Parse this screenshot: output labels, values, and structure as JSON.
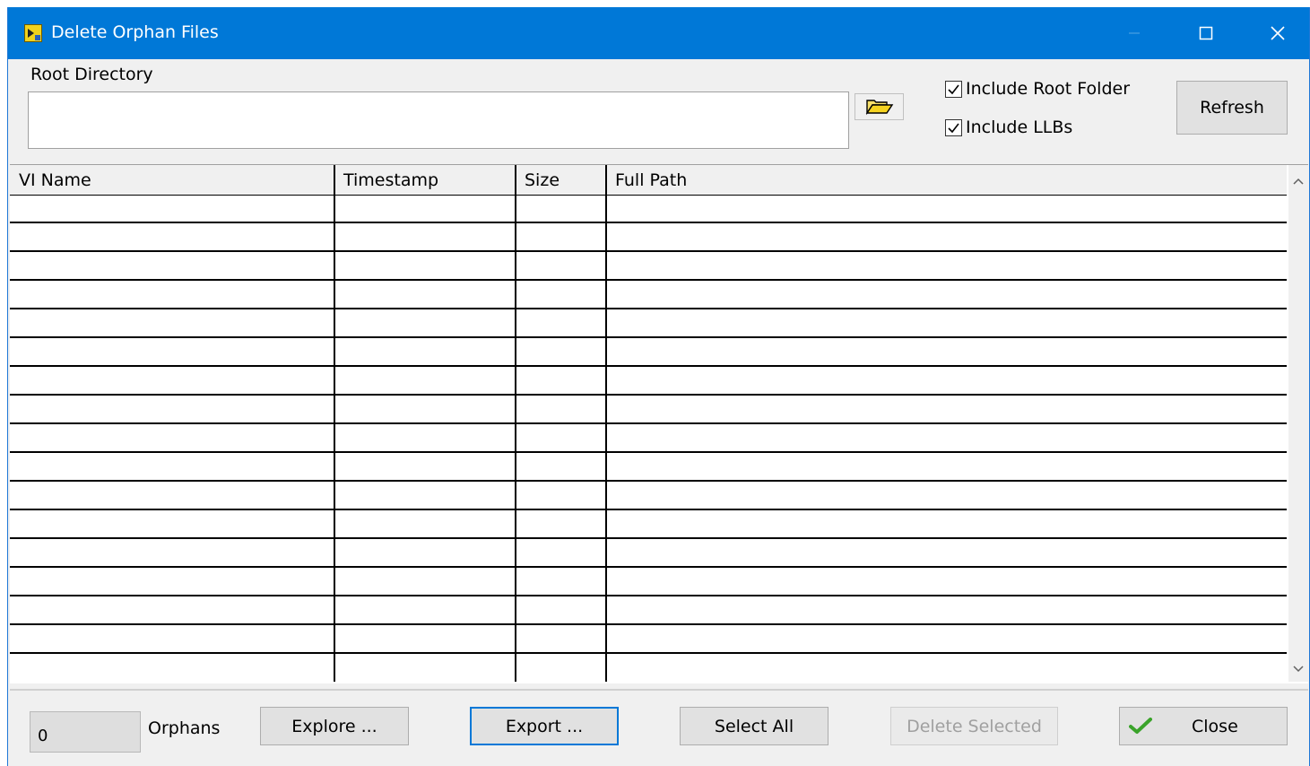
{
  "window": {
    "title": "Delete Orphan Files",
    "controls": {
      "minimize": "minimize",
      "maximize": "maximize",
      "close": "close"
    }
  },
  "root_directory": {
    "label": "Root Directory",
    "value": ""
  },
  "options": {
    "include_root_folder": {
      "label": "Include Root Folder",
      "checked": true
    },
    "include_llbs": {
      "label": "Include LLBs",
      "checked": true
    }
  },
  "buttons": {
    "refresh": "Refresh",
    "explore": "Explore ...",
    "export": "Export ...",
    "select_all": "Select All",
    "delete_selected": "Delete Selected",
    "close": "Close"
  },
  "table": {
    "columns": [
      "VI Name",
      "Timestamp",
      "Size",
      "Full Path"
    ],
    "rows": []
  },
  "footer": {
    "count": "0",
    "count_label": "Orphans"
  },
  "icons": {
    "app": "labview-app-icon",
    "folder": "folder-open-icon",
    "close_check": "green-checkmark-icon"
  },
  "colors": {
    "titlebar": "#0078d7",
    "focus_border": "#0078d7",
    "check_green": "#3aa32a"
  }
}
